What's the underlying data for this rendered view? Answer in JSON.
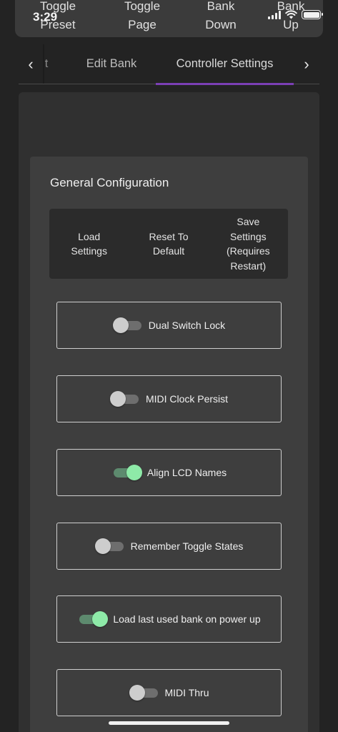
{
  "status_bar": {
    "time": "3:29"
  },
  "top_actions": [
    {
      "line1": "Toggle",
      "line2": "Preset"
    },
    {
      "line1": "Toggle",
      "line2": "Page"
    },
    {
      "line1": "Bank",
      "line2": "Down"
    },
    {
      "line1": "Bank",
      "line2": "Up"
    }
  ],
  "tabs": {
    "partial_label": "t",
    "edit_bank": "Edit Bank",
    "controller_settings": "Controller Settings",
    "prev_icon": "chevron-left-icon",
    "next_icon": "chevron-right-icon",
    "accent_color": "#7b3fb5"
  },
  "general": {
    "title": "General Configuration",
    "actions": [
      {
        "lines": [
          "Load",
          "Settings"
        ]
      },
      {
        "lines": [
          "Reset To",
          "Default"
        ]
      },
      {
        "lines": [
          "Save",
          "Settings",
          "(Requires",
          "Restart)"
        ]
      }
    ],
    "settings": [
      {
        "label": "Dual Switch Lock",
        "on": false
      },
      {
        "label": "MIDI Clock Persist",
        "on": false
      },
      {
        "label": "Align LCD Names",
        "on": true
      },
      {
        "label": "Remember Toggle States",
        "on": false
      },
      {
        "label": "Load last used bank on power up",
        "on": true
      },
      {
        "label": "MIDI Thru",
        "on": false
      }
    ]
  },
  "colors": {
    "switch_on": "#8eeaa8",
    "switch_off": "#cdcdcd",
    "background": "#232323"
  }
}
